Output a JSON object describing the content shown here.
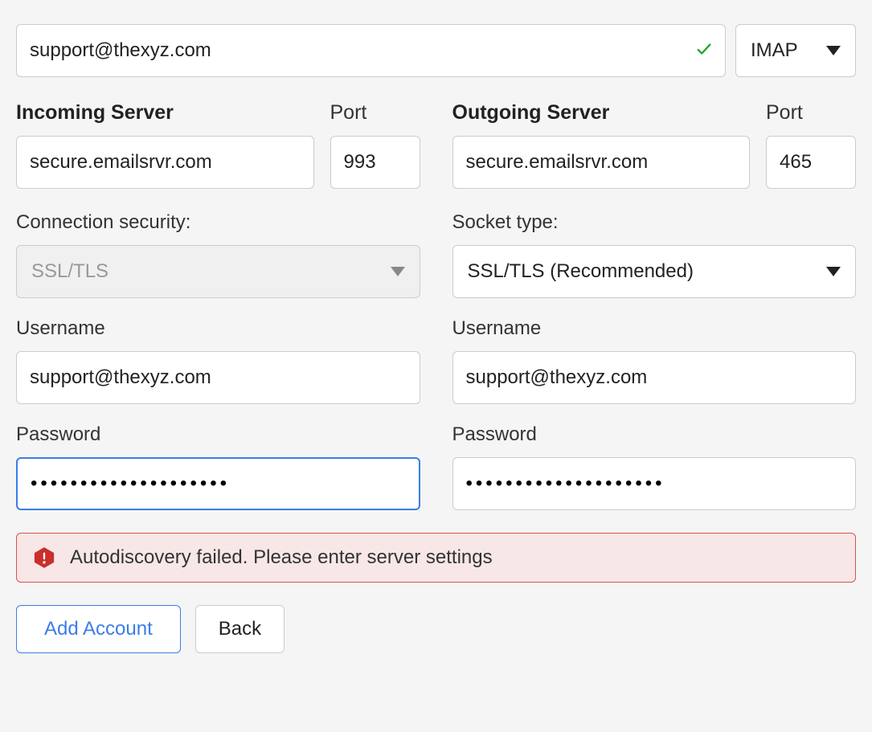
{
  "email": {
    "value": "support@thexyz.com",
    "validated": true
  },
  "protocol": {
    "value": "IMAP"
  },
  "incoming": {
    "header": "Incoming Server",
    "port_label": "Port",
    "server": "secure.emailsrvr.com",
    "port": "993",
    "security_label": "Connection security:",
    "security_value": "SSL/TLS",
    "username_label": "Username",
    "username": "support@thexyz.com",
    "password_label": "Password",
    "password": "••••••••••••••••••••"
  },
  "outgoing": {
    "header": "Outgoing Server",
    "port_label": "Port",
    "server": "secure.emailsrvr.com",
    "port": "465",
    "socket_label": "Socket type:",
    "socket_value": "SSL/TLS (Recommended)",
    "username_label": "Username",
    "username": "support@thexyz.com",
    "password_label": "Password",
    "password": "••••••••••••••••••••"
  },
  "error": {
    "message": "Autodiscovery failed. Please enter server settings"
  },
  "buttons": {
    "add": "Add Account",
    "back": "Back"
  }
}
